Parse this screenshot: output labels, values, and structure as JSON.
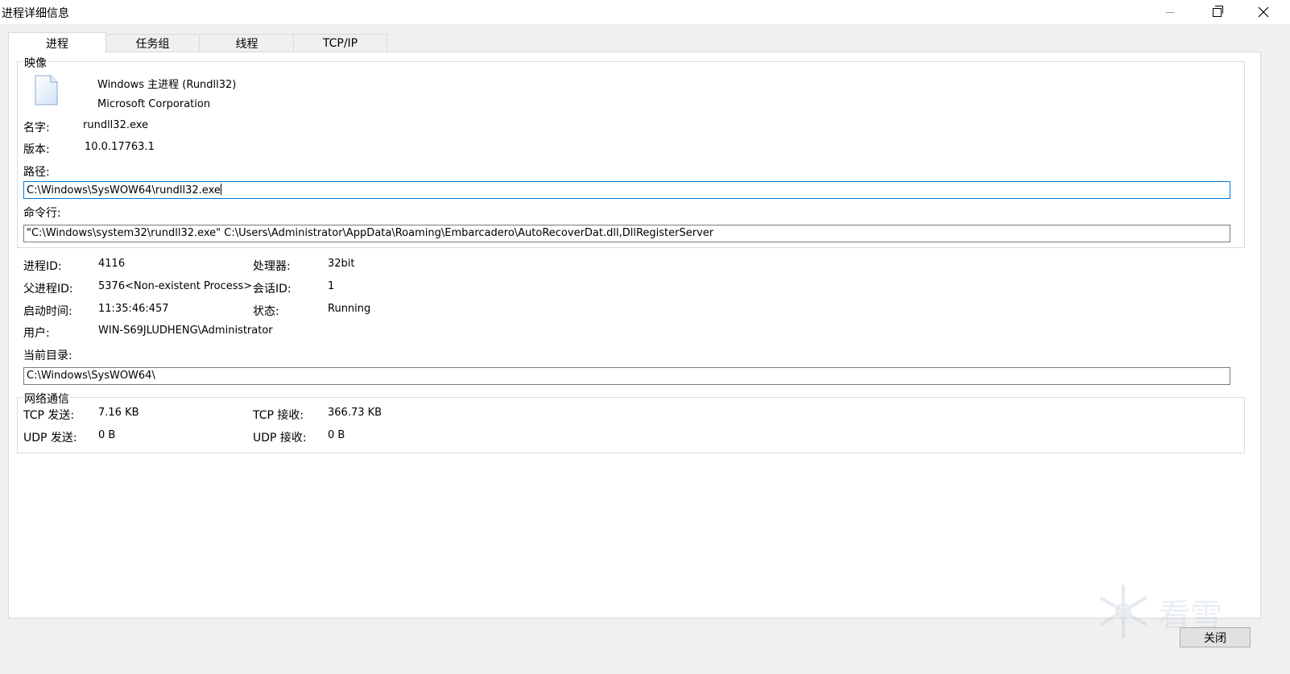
{
  "window": {
    "title": "进程详细信息"
  },
  "tabs": [
    {
      "label": "进程",
      "active": true
    },
    {
      "label": "任务组",
      "active": false
    },
    {
      "label": "线程",
      "active": false
    },
    {
      "label": "TCP/IP",
      "active": false
    }
  ],
  "image_group": {
    "title": "映像",
    "icon": "file-icon",
    "description": "Windows 主进程 (Rundll32)",
    "company": "Microsoft Corporation",
    "name_label": "名字:",
    "name_value": "rundll32.exe",
    "version_label": "版本:",
    "version_value": "10.0.17763.1",
    "path_label": "路径:",
    "path_value": "C:\\Windows\\SysWOW64\\rundll32.exe",
    "cmdline_label": "命令行:",
    "cmdline_value": "\"C:\\Windows\\system32\\rundll32.exe\"  C:\\Users\\Administrator\\AppData\\Roaming\\Embarcadero\\AutoRecoverDat.dll,DllRegisterServer"
  },
  "process_info": {
    "pid_label": "进程ID:",
    "pid_value": "4116",
    "cpu_label": "处理器:",
    "cpu_value": "32bit",
    "ppid_label": "父进程ID:",
    "ppid_value": "5376<Non-existent Process>",
    "session_label": "会话ID:",
    "session_value": "1",
    "start_label": "启动时间:",
    "start_value": "11:35:46:457",
    "status_label": "状态:",
    "status_value": "Running",
    "user_label": "用户:",
    "user_value": "WIN-S69JLUDHENG\\Administrator",
    "cwd_label": "当前目录:",
    "cwd_value": "C:\\Windows\\SysWOW64\\"
  },
  "network": {
    "title": "网络通信",
    "tcp_send_label": "TCP 发送:",
    "tcp_send_value": "7.16 KB",
    "tcp_recv_label": "TCP 接收:",
    "tcp_recv_value": "366.73 KB",
    "udp_send_label": "UDP 发送:",
    "udp_send_value": "0 B",
    "udp_recv_label": "UDP 接收:",
    "udp_recv_value": "0 B"
  },
  "watermark": {
    "text": "看雪",
    "icon": "snowflake-icon"
  },
  "footer": {
    "close_label": "关闭"
  },
  "colors": {
    "focus_border": "#0078d7",
    "panel_bg": "#ffffff",
    "window_bg": "#f0f0f0"
  }
}
